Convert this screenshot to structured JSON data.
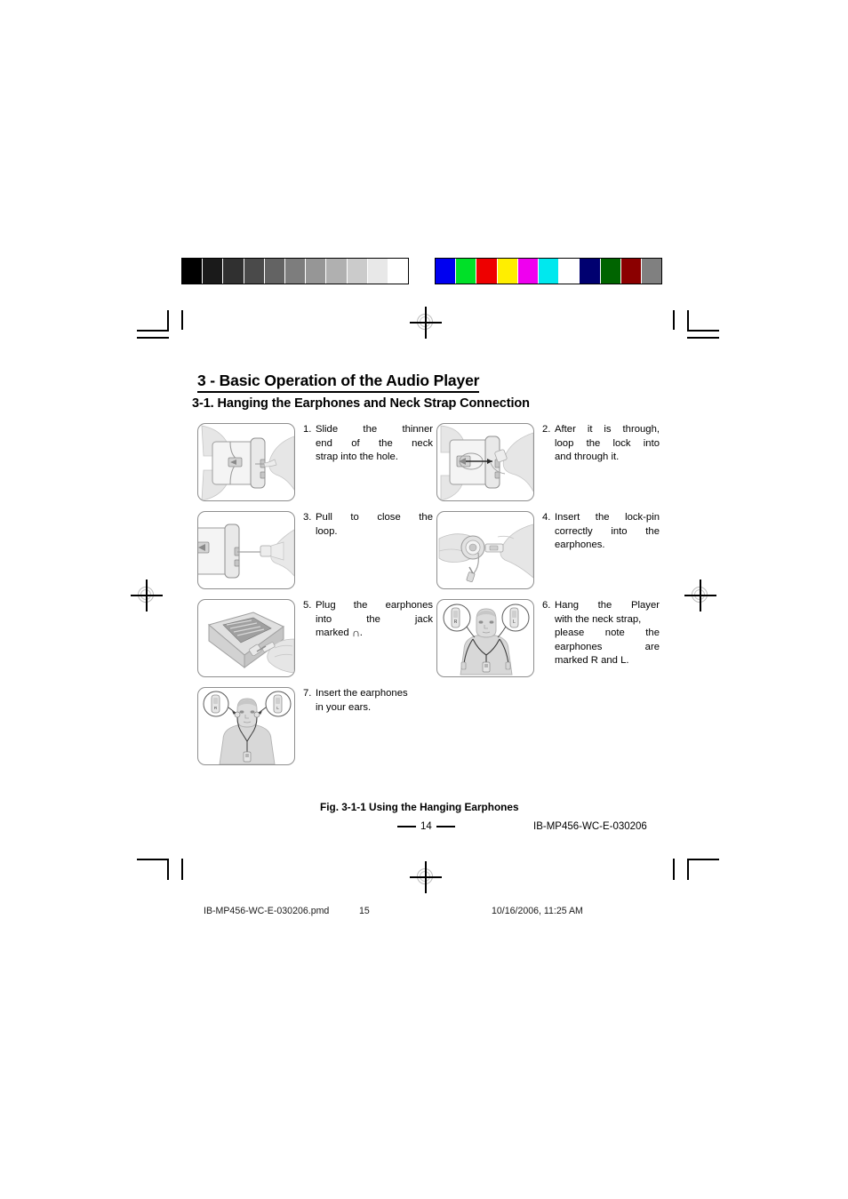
{
  "document": {
    "chapter_title": "3 - Basic Operation of the Audio Player",
    "section_title": "3-1. Hanging the Earphones and Neck Strap Connection",
    "figure_caption": "Fig. 3-1-1 Using the Hanging Earphones",
    "page_number": "14",
    "document_code": "IB-MP456-WC-E-030206"
  },
  "steps": [
    {
      "number": "1.",
      "lines": [
        "Slide the thinner",
        "end of the neck",
        "strap into the hole."
      ],
      "illustration": "player-with-neck-strap-insert"
    },
    {
      "number": "2.",
      "lines": [
        "After it is through,",
        "loop the lock into",
        "and through it."
      ],
      "illustration": "player-loop-lock-through"
    },
    {
      "number": "3.",
      "lines": [
        "Pull to close the",
        "loop."
      ],
      "illustration": "player-pull-close-loop"
    },
    {
      "number": "4.",
      "lines": [
        "Insert the lock-pin",
        "correctly into the",
        "earphones."
      ],
      "illustration": "hands-insert-lock-pin-earphone"
    },
    {
      "number": "5.",
      "lines": [
        "Plug the earphones",
        "into the jack",
        "marked"
      ],
      "trailing_symbol": "∩",
      "trailing_symbol_name": "headphone-jack-symbol",
      "trailing_text": ".",
      "illustration": "player-plug-earphones-into-jack"
    },
    {
      "number": "6.",
      "lines": [
        "Hang the Player",
        "with the neck strap,",
        "please note the",
        "earphones are",
        "marked R and L."
      ],
      "illustration": "person-wearing-player-neck-strap"
    },
    {
      "number": "7.",
      "lines": [
        "Insert the earphones",
        "in your ears."
      ],
      "illustration": "person-inserting-earphones-in-ears"
    }
  ],
  "earphone_markers": {
    "right": "R",
    "left": "L"
  },
  "print_footer": {
    "file_name": "IB-MP456-WC-E-030206.pmd",
    "sheet_number": "15",
    "timestamp": "10/16/2006, 11:25 AM"
  },
  "calibration": {
    "grayscale_label": "grayscale-calibration-bar",
    "grayscale_swatches": [
      "#000000",
      "#1a1a1a",
      "#303030",
      "#4a4a4a",
      "#636363",
      "#7d7d7d",
      "#969696",
      "#b0b0b0",
      "#cbcbcb",
      "#e8e8e8",
      "#ffffff"
    ],
    "color_label": "color-calibration-bar",
    "color_swatches": [
      "#0000f0",
      "#00e028",
      "#ee0000",
      "#ffee00",
      "#ef00ef",
      "#00e8ee",
      "#ffffff",
      "#000070",
      "#006400",
      "#8b0000",
      "#808080"
    ]
  }
}
